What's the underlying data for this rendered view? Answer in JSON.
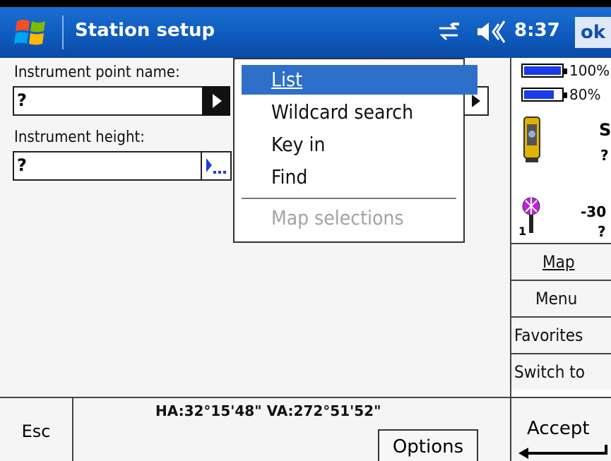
{
  "titlebar": {
    "title": "Station setup",
    "time": "8:37",
    "ok_label": "ok",
    "icons": [
      "windows-start-icon",
      "connectivity-icon",
      "volume-icon"
    ]
  },
  "form": {
    "instrument_point_label": "Instrument point name:",
    "instrument_point_value": "?",
    "instrument_height_label": "Instrument height:",
    "instrument_height_value": "?"
  },
  "dropdown_menu": {
    "items": [
      {
        "label": "List",
        "selected": true,
        "enabled": true
      },
      {
        "label": "Wildcard search",
        "selected": false,
        "enabled": true
      },
      {
        "label": "Key in",
        "selected": false,
        "enabled": true
      },
      {
        "label": "Find",
        "selected": false,
        "enabled": true
      },
      {
        "label": "Map selections",
        "selected": false,
        "enabled": false
      }
    ]
  },
  "status_panel": {
    "battery1_percent": "100%",
    "battery1_level": 1.0,
    "battery2_percent": "80%",
    "battery2_level": 0.8,
    "instrument_letter": "S",
    "instrument_value": "?",
    "target_height": "-30",
    "target_value": "?",
    "target_number": "1"
  },
  "side_buttons": [
    "Map",
    "Menu",
    "Favorites",
    "Switch to"
  ],
  "bottom": {
    "esc_label": "Esc",
    "angles": "HA:32°15'48\"  VA:272°51'52\"",
    "options_label": "Options",
    "accept_label": "Accept"
  },
  "colors": {
    "titlebar": "#1060c8",
    "selection": "#2d6fc9",
    "battery": "#1a3be8"
  }
}
